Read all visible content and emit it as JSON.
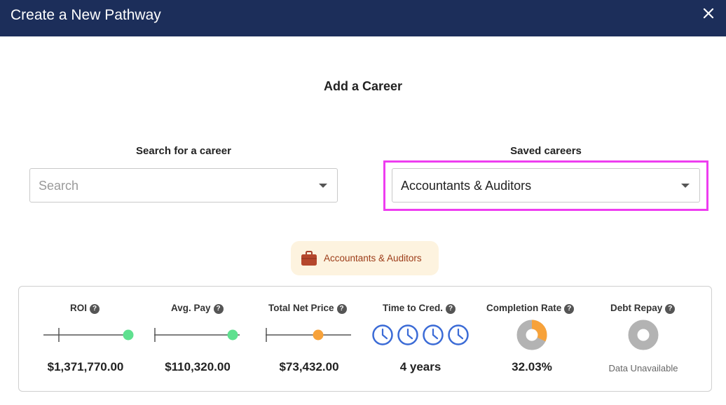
{
  "dialog": {
    "title": "Create a New Pathway",
    "close_icon": "close-icon"
  },
  "heading": "Add a Career",
  "search": {
    "label": "Search for a career",
    "placeholder": "Search"
  },
  "saved": {
    "label": "Saved careers",
    "selected": "Accountants & Auditors"
  },
  "career_chip": {
    "icon": "briefcase-icon",
    "label": "Accountants & Auditors"
  },
  "metrics": {
    "roi": {
      "label": "ROI",
      "value": "$1,371,770.00",
      "level": 0.84,
      "color": "#5fe08f"
    },
    "avg_pay": {
      "label": "Avg. Pay",
      "value": "$110,320.00",
      "level": 0.9,
      "color": "#5fe08f"
    },
    "net_price": {
      "label": "Total Net Price",
      "value": "$73,432.00",
      "level": 0.61,
      "color": "#f7a23a"
    },
    "time_to_cred": {
      "label": "Time to Cred.",
      "value": "4 years",
      "clocks": 4,
      "icon": "clock-icon",
      "color": "#3b6bd6"
    },
    "completion": {
      "label": "Completion Rate",
      "value": "32.03%",
      "percent": 32.03,
      "color": "#f7a23a"
    },
    "debt_repay": {
      "label": "Debt Repay",
      "note": "Data Unavailable"
    }
  }
}
